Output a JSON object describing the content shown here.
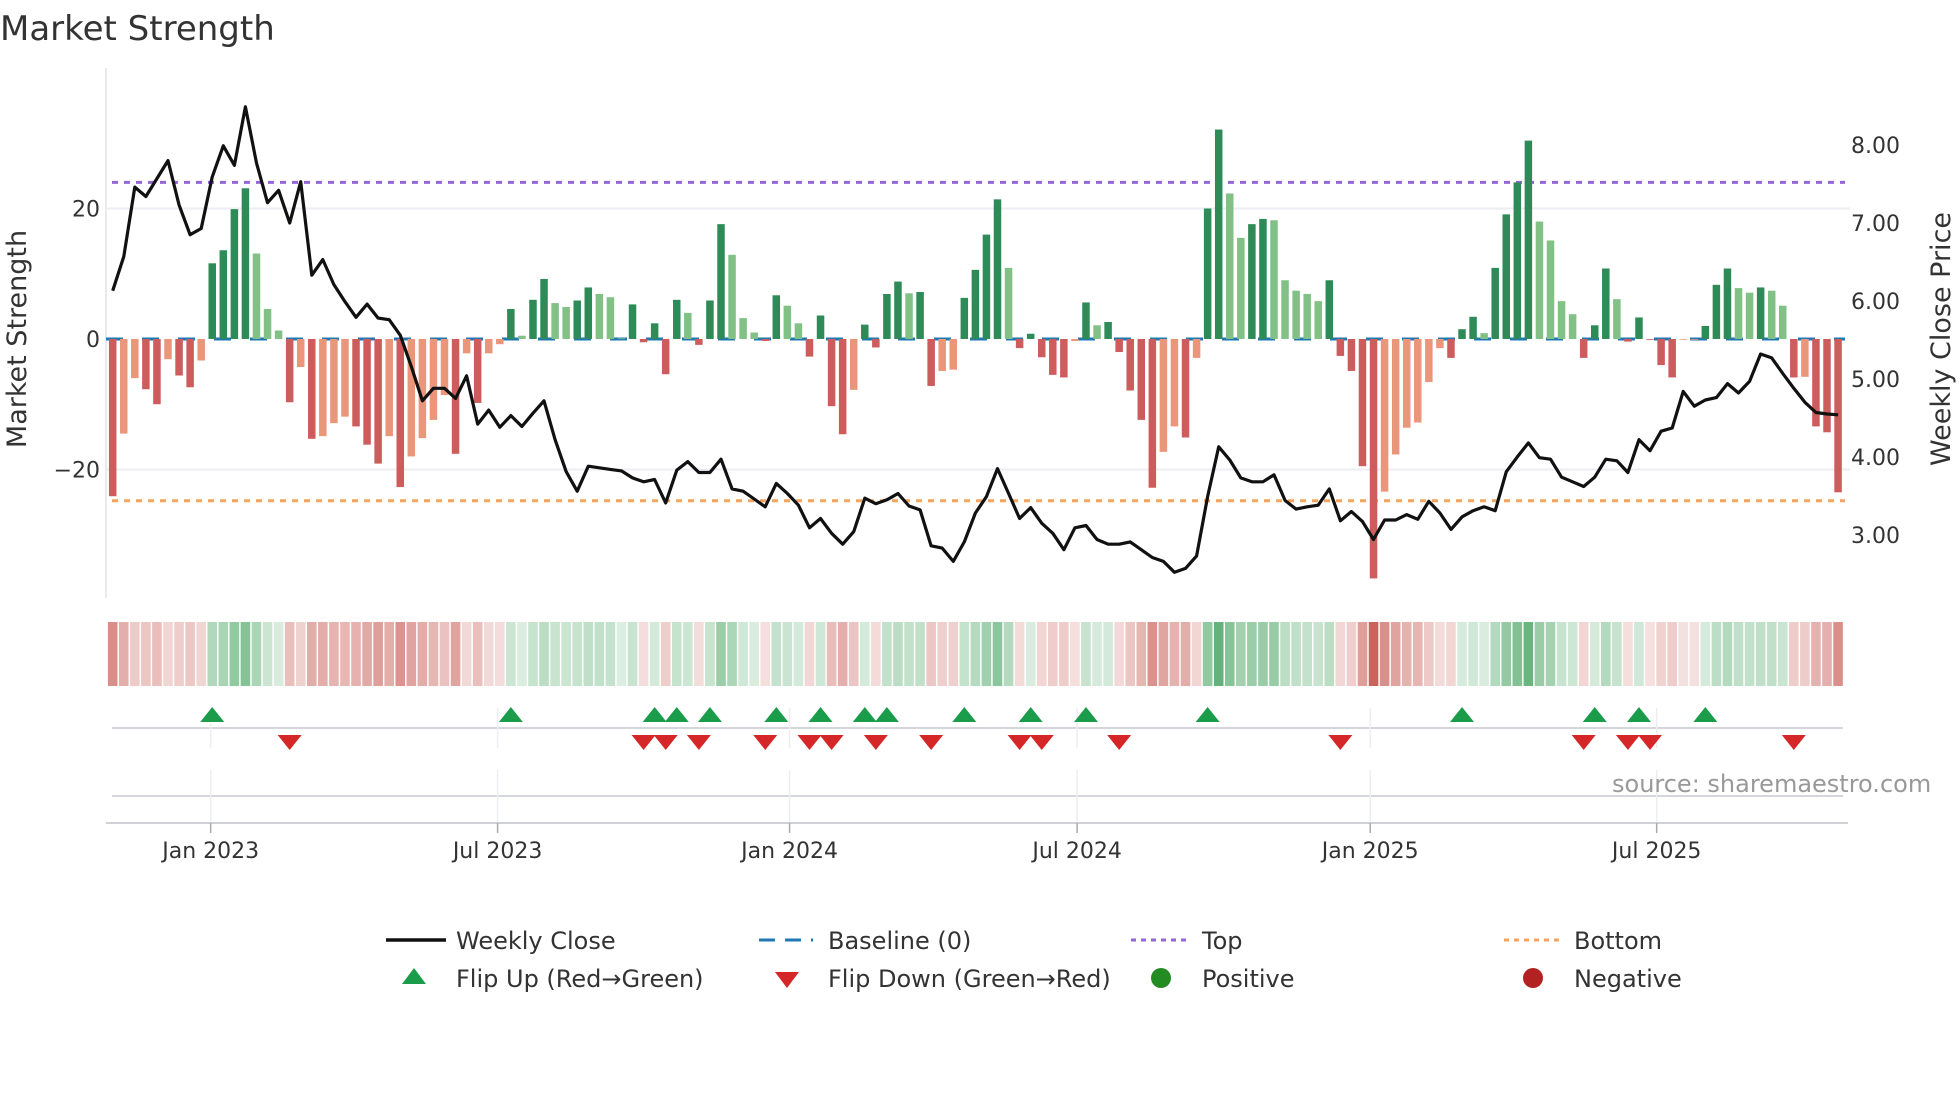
{
  "title": "Market Strength",
  "source": "source: sharemaestro.com",
  "legend": {
    "weekly_close": "Weekly Close",
    "baseline": "Baseline (0)",
    "top": "Top",
    "bottom": "Bottom",
    "flip_up": "Flip Up (Red→Green)",
    "flip_down": "Flip Down (Green→Red)",
    "positive": "Positive",
    "negative": "Negative"
  },
  "colors": {
    "pos_strong": "#2e8b57",
    "pos_weak": "#82c185",
    "neg_strong": "#cd5c5c",
    "neg_weak": "#e9967a",
    "baseline": "#1f77b4",
    "top": "#9467d6",
    "bottom": "#f4a460",
    "line": "#111111",
    "flip_up": "#1a9c4a",
    "flip_down": "#d62728",
    "positive": "#228b22",
    "negative": "#b22222"
  },
  "chart_data": {
    "type": "bar+line",
    "title": "Market Strength",
    "ylabel_left": "Market Strength",
    "ylabel_right": "Weekly Close Price",
    "ylim_left": [
      -39.7,
      40.0
    ],
    "ylim_right": [
      2.19,
      8.86
    ],
    "yticks_left": [
      {
        "value": 20,
        "label": "20"
      },
      {
        "value": 0,
        "label": "0"
      },
      {
        "value": -20,
        "label": "−20"
      }
    ],
    "yticks_right": [
      {
        "value": 8,
        "label": "8.00"
      },
      {
        "value": 7,
        "label": "7.00"
      },
      {
        "value": 6,
        "label": "6.00"
      },
      {
        "value": 5,
        "label": "5.00"
      },
      {
        "value": 4,
        "label": "4.00"
      },
      {
        "value": 3,
        "label": "3.00"
      }
    ],
    "xticks": [
      {
        "week": 8.86,
        "label": "Jan 2023"
      },
      {
        "week": 34.8,
        "label": "Jul 2023"
      },
      {
        "week": 61.2,
        "label": "Jan 2024"
      },
      {
        "week": 87.2,
        "label": "Jul 2024"
      },
      {
        "week": 113.7,
        "label": "Jan 2025"
      },
      {
        "week": 139.6,
        "label": "Jul 2025"
      }
    ],
    "top_level": 24,
    "bottom_level": -24.8,
    "baseline_level": 0,
    "strength": [
      -24.1,
      -14.5,
      -6.0,
      -7.7,
      -10.0,
      -3.1,
      -5.6,
      -7.4,
      -3.3,
      11.6,
      13.6,
      19.9,
      23.1,
      13.1,
      4.6,
      1.3,
      -9.7,
      -4.3,
      -15.3,
      -14.9,
      -12.9,
      -11.9,
      -13.4,
      -16.2,
      -19.1,
      -14.9,
      -22.7,
      -18.0,
      -15.2,
      -12.4,
      -8.6,
      -17.6,
      -2.2,
      -9.8,
      -2.2,
      -0.8,
      4.6,
      0.5,
      6.0,
      9.2,
      5.5,
      4.9,
      5.9,
      7.9,
      6.9,
      6.4,
      0.1,
      5.3,
      -0.5,
      2.4,
      -5.4,
      6.0,
      4.0,
      -0.9,
      5.9,
      17.6,
      12.9,
      3.2,
      1.0,
      -0.3,
      6.7,
      5.1,
      2.4,
      -2.7,
      3.6,
      -10.3,
      -14.6,
      -7.8,
      2.2,
      -1.3,
      6.9,
      8.8,
      7.0,
      7.2,
      -7.2,
      -4.9,
      -4.7,
      6.3,
      10.6,
      16.0,
      21.4,
      10.9,
      -1.4,
      0.8,
      -2.8,
      -5.5,
      -5.9,
      -0.3,
      5.6,
      2.1,
      2.6,
      -2.0,
      -7.9,
      -12.4,
      -22.8,
      -17.3,
      -13.4,
      -15.1,
      -2.9,
      20.0,
      32.1,
      22.3,
      15.5,
      17.6,
      18.4,
      18.2,
      9.0,
      7.4,
      6.9,
      5.8,
      9.0,
      -2.6,
      -4.9,
      -19.5,
      -36.7,
      -23.4,
      -17.7,
      -13.6,
      -12.8,
      -6.6,
      -1.4,
      -2.9,
      1.5,
      3.4,
      0.9,
      10.9,
      19.1,
      24.0,
      30.4,
      18.0,
      15.1,
      5.8,
      3.8,
      -2.9,
      2.1,
      10.8,
      6.1,
      -0.4,
      3.3,
      -0.1,
      -4.0,
      -5.9,
      -0.1,
      -0.1,
      2.0,
      8.3,
      10.8,
      7.8,
      7.1,
      7.9,
      7.4,
      5.1,
      -5.9,
      -5.8,
      -13.4,
      -14.3,
      -23.5
    ],
    "weekly_close": [
      6.13,
      6.57,
      7.46,
      7.34,
      7.57,
      7.8,
      7.23,
      6.85,
      6.93,
      7.59,
      7.99,
      7.74,
      8.49,
      7.77,
      7.26,
      7.42,
      7.0,
      7.53,
      6.33,
      6.53,
      6.21,
      5.99,
      5.79,
      5.96,
      5.78,
      5.76,
      5.56,
      5.16,
      4.72,
      4.88,
      4.88,
      4.75,
      5.04,
      4.42,
      4.6,
      4.38,
      4.53,
      4.39,
      4.56,
      4.72,
      4.22,
      3.81,
      3.56,
      3.88,
      3.86,
      3.84,
      3.82,
      3.73,
      3.68,
      3.71,
      3.41,
      3.83,
      3.94,
      3.8,
      3.8,
      3.97,
      3.59,
      3.56,
      3.46,
      3.36,
      3.66,
      3.53,
      3.38,
      3.09,
      3.21,
      3.02,
      2.88,
      3.04,
      3.47,
      3.4,
      3.45,
      3.53,
      3.37,
      3.32,
      2.86,
      2.83,
      2.66,
      2.91,
      3.28,
      3.49,
      3.85,
      3.53,
      3.21,
      3.35,
      3.15,
      3.02,
      2.81,
      3.09,
      3.12,
      2.94,
      2.88,
      2.88,
      2.91,
      2.81,
      2.71,
      2.66,
      2.52,
      2.57,
      2.73,
      3.49,
      4.13,
      3.96,
      3.73,
      3.68,
      3.68,
      3.77,
      3.44,
      3.33,
      3.36,
      3.38,
      3.59,
      3.18,
      3.3,
      3.17,
      2.94,
      3.19,
      3.19,
      3.26,
      3.2,
      3.43,
      3.28,
      3.07,
      3.23,
      3.31,
      3.36,
      3.31,
      3.81,
      4.0,
      4.18,
      3.99,
      3.97,
      3.74,
      3.68,
      3.62,
      3.74,
      3.97,
      3.95,
      3.8,
      4.22,
      4.08,
      4.33,
      4.37,
      4.84,
      4.65,
      4.73,
      4.76,
      4.94,
      4.82,
      4.97,
      5.32,
      5.27,
      5.07,
      4.88,
      4.7,
      4.57,
      4.55,
      4.54
    ]
  }
}
